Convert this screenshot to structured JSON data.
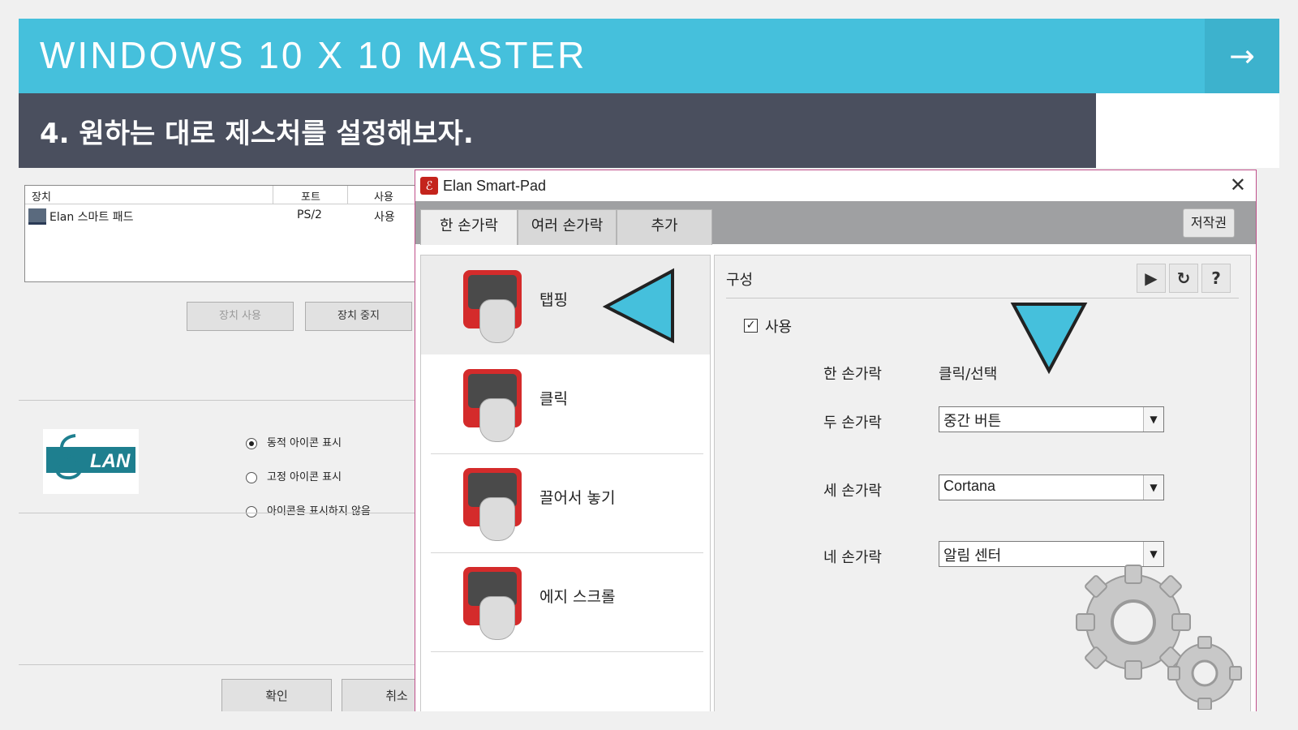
{
  "banner": {
    "title": "WINDOWS 10 X 10 MASTER",
    "next_icon": "→"
  },
  "subtitle": "4. 원하는 대로 제스처를 설정해보자.",
  "background_dialog": {
    "table_headers": [
      "장치",
      "포트",
      "사용"
    ],
    "row": {
      "device": "Elan 스마트 패드",
      "port": "PS/2",
      "status": "사용"
    },
    "enable_button": "장치 사용",
    "disable_button": "장치 중지",
    "logo_text": "LAN",
    "radio_options": [
      {
        "label": "동적 아이콘 표시",
        "selected": true
      },
      {
        "label": "고정 아이콘 표시",
        "selected": false
      },
      {
        "label": "아이콘을 표시하지 않음",
        "selected": false
      }
    ],
    "ok_button": "확인",
    "cancel_button": "취소"
  },
  "window": {
    "title": "Elan Smart-Pad",
    "close": "✕",
    "tabs": [
      "한 손가락",
      "여러 손가락",
      "추가"
    ],
    "copyright_button": "저작권",
    "gesture_items": [
      "탭핑",
      "클릭",
      "끌어서 놓기",
      "에지 스크롤"
    ],
    "config": {
      "heading": "구성",
      "play_icon": "▶",
      "refresh_icon": "↻",
      "help_icon": "?",
      "enable_label": "사용",
      "enabled": true,
      "rows": [
        {
          "label": "한 손가락",
          "value": "클릭/선택"
        },
        {
          "label": "두 손가락",
          "value": "중간 버튼"
        },
        {
          "label": "세 손가락",
          "value": "Cortana"
        },
        {
          "label": "네 손가락",
          "value": "알림 센터"
        }
      ]
    }
  },
  "colors": {
    "banner": "#45c0dc",
    "subbar": "#4a4f5e",
    "arrow": "#45c0dc",
    "pad_red": "#d42b2b"
  }
}
